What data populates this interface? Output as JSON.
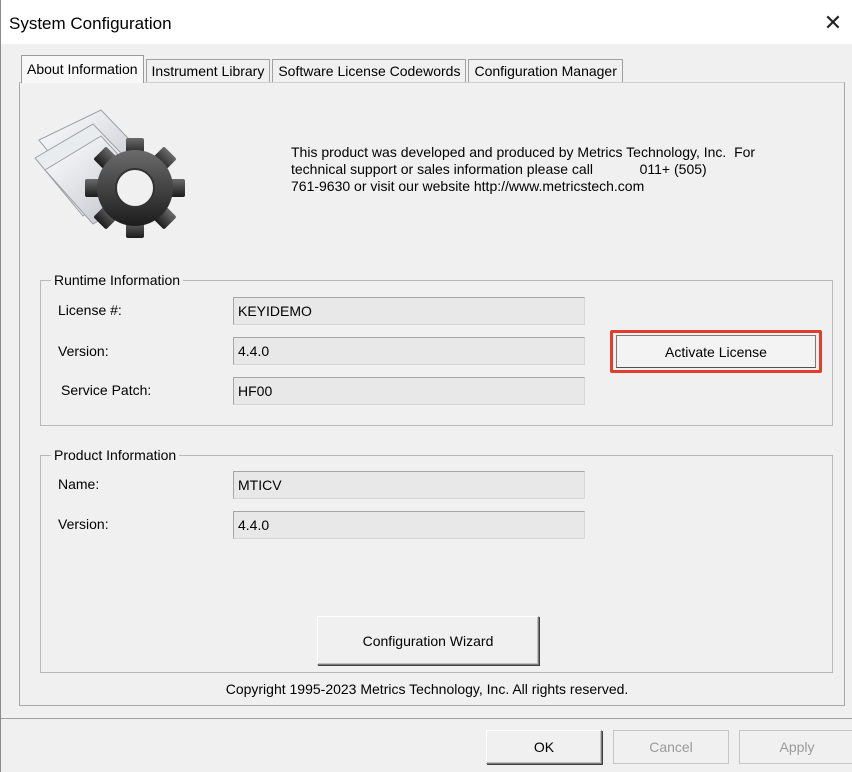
{
  "window": {
    "title": "System Configuration",
    "close_glyph": "✕"
  },
  "tabs": [
    {
      "label": "About Information",
      "active": true
    },
    {
      "label": "Instrument Library",
      "active": false
    },
    {
      "label": "Software License Codewords",
      "active": false
    },
    {
      "label": "Configuration Manager",
      "active": false
    }
  ],
  "about": {
    "icon": "gear-documents-icon",
    "line1": "This product was developed and produced by Metrics Technology, Inc.  For",
    "line2": "technical support or sales information please call            011+ (505)",
    "line3": "761-9630 or visit our website http://www.metricstech.com"
  },
  "runtime": {
    "group_label": "Runtime Information",
    "license_label": "License #:",
    "license_value": "KEYIDEMO",
    "version_label": "Version:",
    "version_value": "4.4.0",
    "patch_label": "Service Patch:",
    "patch_value": "HF00",
    "activate_label": "Activate License",
    "highlight_color": "#e23e2b"
  },
  "product": {
    "group_label": "Product Information",
    "name_label": "Name:",
    "name_value": "MTICV",
    "version_label": "Version:",
    "version_value": "4.4.0",
    "wizard_label": "Configuration Wizard"
  },
  "footer": {
    "copyright": "Copyright 1995-2023 Metrics Technology, Inc.  All rights reserved.",
    "ok_label": "OK",
    "cancel_label": "Cancel",
    "apply_label": "Apply"
  }
}
